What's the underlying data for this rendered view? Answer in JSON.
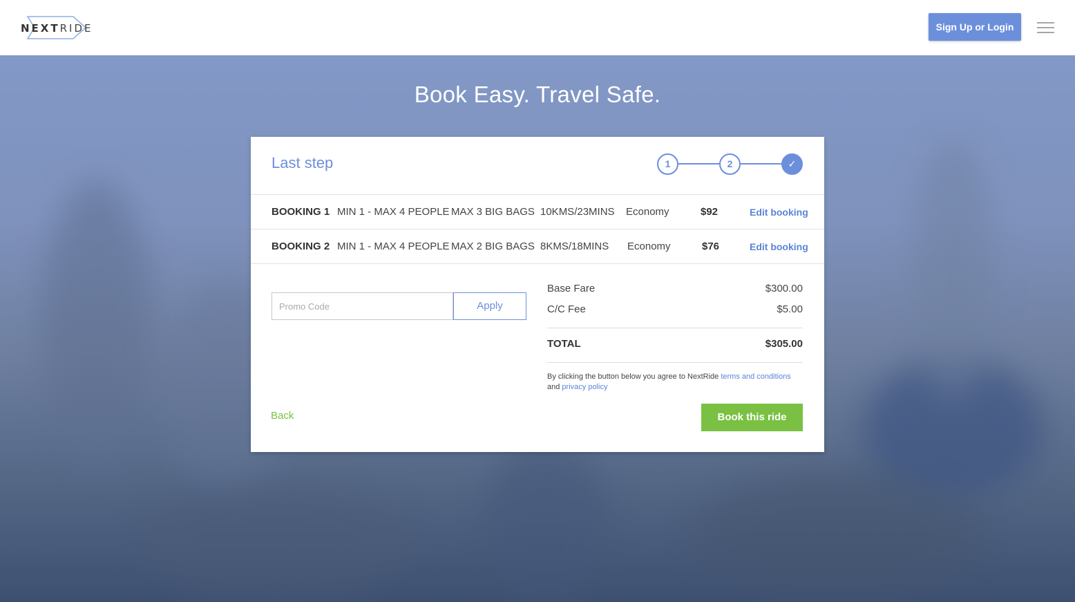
{
  "header": {
    "logo_part1": "NEXT",
    "logo_part2": "RIDE",
    "signup_label": "Sign Up or Login",
    "menu_icon": "hamburger-menu-icon"
  },
  "hero": {
    "headline": "Book Easy. Travel Safe."
  },
  "card": {
    "title": "Last step",
    "steps": [
      "1",
      "2",
      "✓"
    ],
    "bookings": [
      {
        "label": "BOOKING 1",
        "people": "MIN 1 - MAX 4 PEOPLE",
        "bags": "MAX 3 BIG BAGS",
        "distance": "10KMS/23MINS",
        "class": "Economy",
        "price": "$92",
        "edit_label": "Edit booking"
      },
      {
        "label": "BOOKING 2",
        "people": "MIN 1 - MAX 4 PEOPLE",
        "bags": "MAX 2 BIG BAGS",
        "distance": "8KMS/18MINS",
        "class": "Economy",
        "price": "$76",
        "edit_label": "Edit booking"
      }
    ],
    "promo": {
      "placeholder": "Promo Code",
      "value": "",
      "apply_label": "Apply"
    },
    "fare": {
      "base_label": "Base Fare",
      "base_value": "$300.00",
      "fee_label": "C/C Fee",
      "fee_value": "$5.00",
      "total_label": "TOTAL",
      "total_value": "$305.00"
    },
    "terms": {
      "text_before": "By clicking the button below you agree to NextRide ",
      "terms_link": "terms and conditions",
      "text_and": "and ",
      "privacy_link": "privacy policy"
    },
    "back_label": "Back",
    "book_label": "Book this ride"
  },
  "colors": {
    "accent_blue": "#6c8fdc",
    "link_blue": "#5a84d6",
    "cta_green": "#7ac143"
  }
}
